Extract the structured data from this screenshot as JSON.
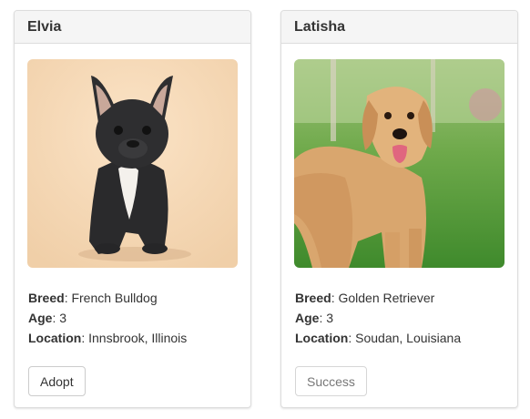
{
  "cards": [
    {
      "name": "Elvia",
      "breed_label": "Breed",
      "breed": "French Bulldog",
      "age_label": "Age",
      "age": "3",
      "location_label": "Location",
      "location": "Innsbrook, Illinois",
      "button_label": "Adopt",
      "photo": "french-bulldog-photo"
    },
    {
      "name": "Latisha",
      "breed_label": "Breed",
      "breed": "Golden Retriever",
      "age_label": "Age",
      "age": "3",
      "location_label": "Location",
      "location": "Soudan, Louisiana",
      "button_label": "Success",
      "button_disabled": true,
      "photo": "golden-retriever-photo"
    }
  ]
}
